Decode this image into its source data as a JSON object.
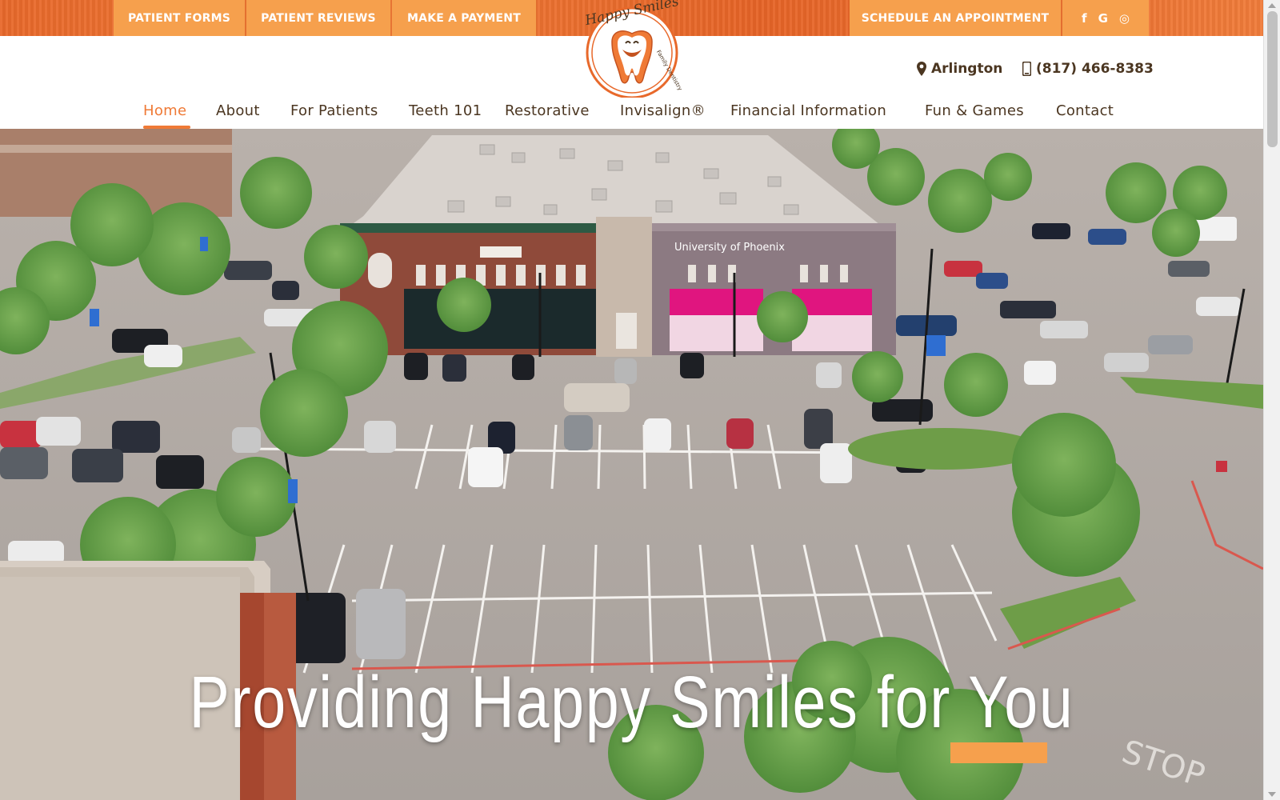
{
  "topbar": {
    "patient_forms": "PATIENT FORMS",
    "patient_reviews": "PATIENT REVIEWS",
    "make_payment": "MAKE A PAYMENT",
    "schedule": "SCHEDULE AN APPOINTMENT",
    "social": {
      "facebook": "f",
      "google": "G",
      "instagram": "◎"
    }
  },
  "logo": {
    "brand": "Happy Smiles",
    "tagline": "Family Dentistry"
  },
  "contact": {
    "location": "Arlington",
    "phone": "(817) 466-8383"
  },
  "nav": {
    "items": [
      {
        "label": "Home"
      },
      {
        "label": "About"
      },
      {
        "label": "For Patients"
      },
      {
        "label": "Teeth 101"
      },
      {
        "label": "Restorative"
      },
      {
        "label": "Invisalign®"
      },
      {
        "label": "Financial Information"
      },
      {
        "label": "Fun & Games"
      },
      {
        "label": "Contact"
      }
    ],
    "active": "Home"
  },
  "hero": {
    "headline": "Providing Happy Smiles for You",
    "sign_university": "University of Phoenix",
    "sign_stop": "STOP"
  },
  "colors": {
    "orange_bar": "#e8692b",
    "button": "#f6a04d",
    "text_brown": "#4b3621",
    "accent": "#ef7a36"
  }
}
